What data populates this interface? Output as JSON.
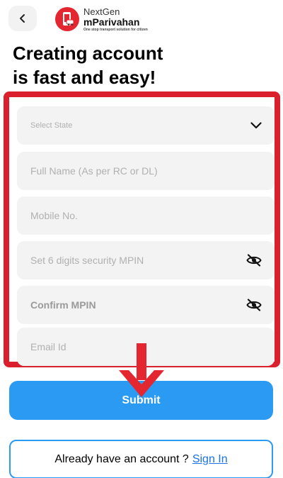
{
  "header": {
    "back_icon": "chevron-left-icon",
    "logo": {
      "top_text": "NextGen",
      "main_text": "mParivahan",
      "tagline": "One stop transport solution for citizen",
      "brand_color": "#e3262f"
    }
  },
  "heading": {
    "line1": "Creating account",
    "line2": "is fast and easy!"
  },
  "form": {
    "highlight_color": "#d9202c",
    "state": {
      "placeholder": "Select State",
      "icon": "chevron-down-icon"
    },
    "full_name": {
      "placeholder": "Full Name (As per RC or DL)"
    },
    "mobile": {
      "placeholder": "Mobile No."
    },
    "mpin": {
      "placeholder": "Set 6 digits security MPIN",
      "icon": "eye-off-icon"
    },
    "confirm_mpin": {
      "placeholder": "Confirm MPIN",
      "icon": "eye-off-icon"
    },
    "email": {
      "placeholder": "Email Id"
    }
  },
  "annotation": {
    "icon": "down-arrow-icon",
    "color": "#e3262f"
  },
  "submit": {
    "label": "Submit",
    "color": "#2b9af3"
  },
  "signin": {
    "prompt": "Already have an account ?",
    "link": "Sign In"
  }
}
